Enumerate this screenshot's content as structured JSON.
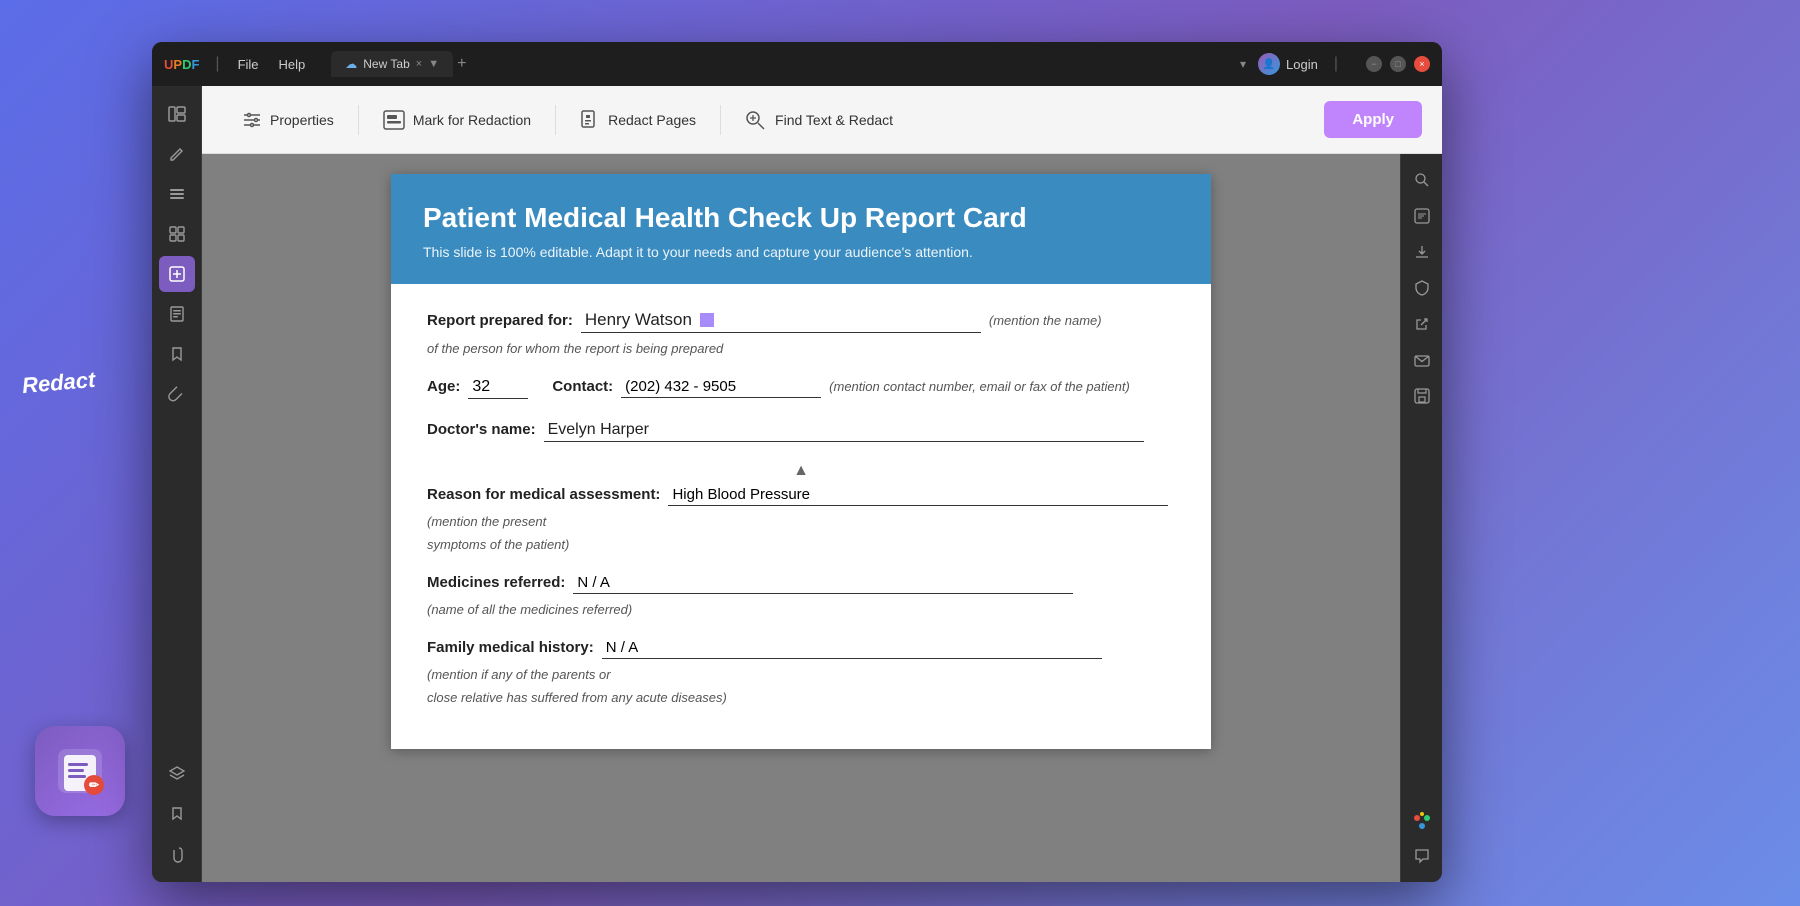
{
  "app": {
    "logo": "UPDF",
    "logo_letters": [
      "U",
      "P",
      "D",
      "F"
    ],
    "menu_items": [
      "File",
      "Help"
    ],
    "tab": {
      "title": "New Tab",
      "cloud_icon": "☁",
      "close_icon": "×",
      "add_icon": "+"
    },
    "window_controls": {
      "minimize": "−",
      "maximize": "□",
      "close": "×"
    },
    "login": "Login",
    "dropdown_arrow": "▾"
  },
  "toolbar": {
    "properties_label": "Properties",
    "mark_for_redaction_label": "Mark for Redaction",
    "redact_pages_label": "Redact Pages",
    "find_text_redact_label": "Find Text & Redact",
    "apply_label": "Apply"
  },
  "left_sidebar": {
    "icons": [
      {
        "name": "panels-icon",
        "symbol": "☰",
        "active": false
      },
      {
        "name": "edit-icon",
        "symbol": "✏",
        "active": false
      },
      {
        "name": "list-icon",
        "symbol": "≡",
        "active": false
      },
      {
        "name": "grid-icon",
        "symbol": "⊞",
        "active": false
      },
      {
        "name": "redact-icon",
        "symbol": "▣",
        "active": true
      },
      {
        "name": "pages-icon",
        "symbol": "⊟",
        "active": false
      },
      {
        "name": "bookmark-icon",
        "symbol": "◫",
        "active": false
      },
      {
        "name": "attach-icon",
        "symbol": "⚓",
        "active": false
      },
      {
        "name": "layers-icon",
        "symbol": "◈",
        "active": false
      },
      {
        "name": "bookmark2-icon",
        "symbol": "🔖",
        "active": false
      },
      {
        "name": "clip-icon",
        "symbol": "📎",
        "active": false
      }
    ]
  },
  "right_sidebar": {
    "icons": [
      {
        "name": "search-icon",
        "symbol": "🔍"
      },
      {
        "name": "ocr-icon",
        "symbol": "T"
      },
      {
        "name": "download-icon",
        "symbol": "⬇"
      },
      {
        "name": "security-icon",
        "symbol": "🔒"
      },
      {
        "name": "share-icon",
        "symbol": "↗"
      },
      {
        "name": "mail-icon",
        "symbol": "✉"
      },
      {
        "name": "save-icon",
        "symbol": "💾"
      },
      {
        "name": "color-icon",
        "symbol": "🎨"
      },
      {
        "name": "comment-icon",
        "symbol": "💬"
      }
    ]
  },
  "pdf": {
    "header": {
      "title": "Patient Medical Health Check Up Report Card",
      "subtitle": "This slide is 100% editable. Adapt it to your needs and capture your audience's attention."
    },
    "form": {
      "prepared_for_label": "Report prepared for:",
      "patient_name": "Henry Watson",
      "name_hint": "(mention the name)",
      "name_subhint": "of the person for whom the report is being prepared",
      "age_label": "Age:",
      "age_value": "32",
      "contact_label": "Contact:",
      "contact_value": "(202) 432 - 9505",
      "contact_hint": "(mention contact number, email or fax of the patient)",
      "doctor_label": "Doctor's name:",
      "doctor_value": "Evelyn  Harper",
      "reason_label": "Reason for medical assessment:",
      "reason_value": "High Blood Pressure",
      "reason_hint": "(mention the present",
      "reason_subhint": "symptoms of the patient)",
      "medicines_label": "Medicines referred:",
      "medicines_value": "N / A",
      "medicines_hint": "(name of all the medicines referred)",
      "family_label": "Family medical history:",
      "family_value": "N / A",
      "family_hint": "(mention if any of the parents or",
      "family_subhint": "close relative has suffered from any acute diseases)"
    }
  },
  "redact_label": "Redact",
  "app_icon": "📝"
}
